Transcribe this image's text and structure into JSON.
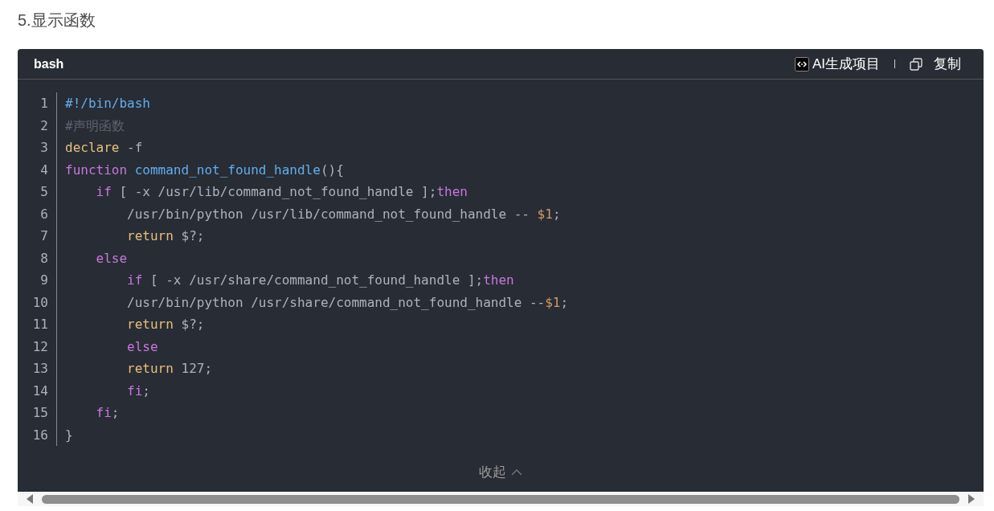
{
  "heading": "5.显示函数",
  "code_block": {
    "language": "bash",
    "ai_button": "AI生成项目",
    "copy_button": "复制",
    "lines": [
      {
        "number": "1",
        "tokens": [
          {
            "kind": "meta",
            "text": "#!/bin/bash"
          }
        ]
      },
      {
        "number": "2",
        "tokens": [
          {
            "kind": "comment",
            "text": "#声明函数"
          }
        ]
      },
      {
        "number": "3",
        "tokens": [
          {
            "kind": "built_in",
            "text": "declare"
          },
          {
            "kind": "plain",
            "text": " -f"
          }
        ]
      },
      {
        "number": "4",
        "tokens": [
          {
            "kind": "keyword",
            "text": "function"
          },
          {
            "kind": "title",
            "text": " command_not_found_handle"
          },
          {
            "kind": "plain",
            "text": "(){"
          }
        ]
      },
      {
        "number": "5",
        "tokens": [
          {
            "kind": "keyword",
            "text": "    if"
          },
          {
            "kind": "plain",
            "text": " [ -x /usr/lib/command_not_found_handle ];"
          },
          {
            "kind": "keyword",
            "text": "then"
          }
        ]
      },
      {
        "number": "6",
        "tokens": [
          {
            "kind": "plain",
            "text": "        /usr/bin/python /usr/lib/command_not_found_handle -- "
          },
          {
            "kind": "variable",
            "text": "$1"
          },
          {
            "kind": "plain",
            "text": ";"
          }
        ]
      },
      {
        "number": "7",
        "tokens": [
          {
            "kind": "built_in",
            "text": "        return"
          },
          {
            "kind": "plain",
            "text": " $?;"
          }
        ]
      },
      {
        "number": "8",
        "tokens": [
          {
            "kind": "keyword",
            "text": "    else"
          }
        ]
      },
      {
        "number": "9",
        "tokens": [
          {
            "kind": "keyword",
            "text": "        if"
          },
          {
            "kind": "plain",
            "text": " [ -x /usr/share/command_not_found_handle ];"
          },
          {
            "kind": "keyword",
            "text": "then"
          }
        ]
      },
      {
        "number": "10",
        "tokens": [
          {
            "kind": "plain",
            "text": "        /usr/bin/python /usr/share/command_not_found_handle --"
          },
          {
            "kind": "variable",
            "text": "$1"
          },
          {
            "kind": "plain",
            "text": ";"
          }
        ]
      },
      {
        "number": "11",
        "tokens": [
          {
            "kind": "built_in",
            "text": "        return"
          },
          {
            "kind": "plain",
            "text": " $?;"
          }
        ]
      },
      {
        "number": "12",
        "tokens": [
          {
            "kind": "keyword",
            "text": "        else"
          }
        ]
      },
      {
        "number": "13",
        "tokens": [
          {
            "kind": "built_in",
            "text": "        return"
          },
          {
            "kind": "plain",
            "text": " 127;"
          }
        ]
      },
      {
        "number": "14",
        "tokens": [
          {
            "kind": "keyword",
            "text": "        fi"
          },
          {
            "kind": "plain",
            "text": ";"
          }
        ]
      },
      {
        "number": "15",
        "tokens": [
          {
            "kind": "keyword",
            "text": "    fi"
          },
          {
            "kind": "plain",
            "text": ";"
          }
        ]
      },
      {
        "number": "16",
        "tokens": [
          {
            "kind": "plain",
            "text": "}"
          }
        ]
      }
    ],
    "collapse_button": "收起"
  }
}
